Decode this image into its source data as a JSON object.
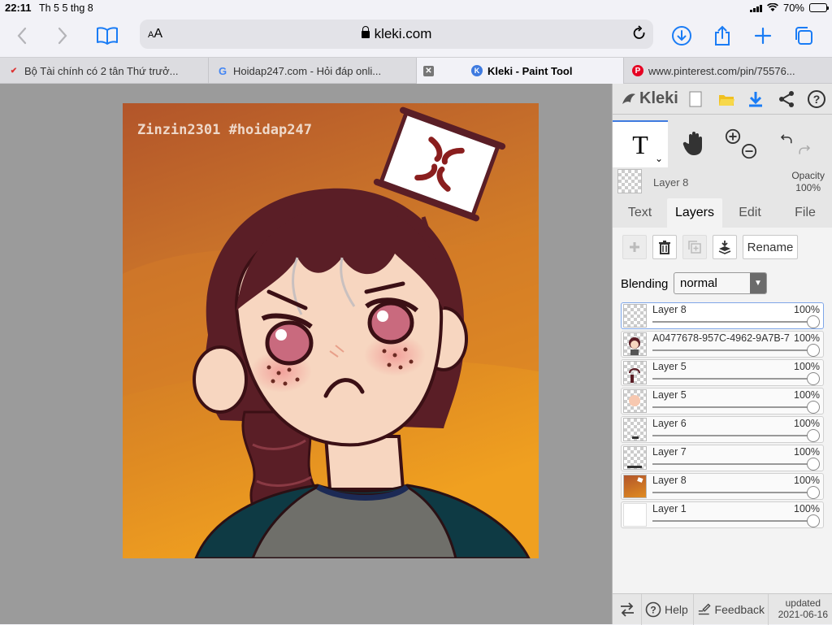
{
  "status": {
    "time": "22:11",
    "date": "Th 5 5 thg 8",
    "battery": "70%",
    "battery_level": 0.7
  },
  "browser": {
    "aa_small": "A",
    "aa_big": "A",
    "url": "kleki.com",
    "tabs": [
      {
        "label": "Bộ Tài chính có 2 tân Thứ trưở..."
      },
      {
        "label": "Hoidap247.com - Hỏi đáp onli..."
      },
      {
        "label": "Kleki - Paint Tool"
      },
      {
        "label": "www.pinterest.com/pin/75576..."
      }
    ]
  },
  "artwork": {
    "watermark": "Zinzin2301 #hoidap247"
  },
  "kleki": {
    "logo": "Kleki",
    "tool_glyph": "T",
    "current_layer": {
      "name": "Layer 8",
      "opacity_label": "Opacity",
      "opacity_value": "100%"
    },
    "tabs": [
      "Text",
      "Layers",
      "Edit",
      "File"
    ],
    "rename_label": "Rename",
    "blending_label": "Blending",
    "blending_value": "normal",
    "layers": [
      {
        "name": "Layer 8",
        "opacity": "100%"
      },
      {
        "name": "A0477678-957C-4962-9A7B-7",
        "opacity": "100%"
      },
      {
        "name": "Layer 5",
        "opacity": "100%"
      },
      {
        "name": "Layer 5",
        "opacity": "100%"
      },
      {
        "name": "Layer 6",
        "opacity": "100%"
      },
      {
        "name": "Layer 7",
        "opacity": "100%"
      },
      {
        "name": "Layer 8",
        "opacity": "100%"
      },
      {
        "name": "Layer 1",
        "opacity": "100%"
      }
    ],
    "footer": {
      "help": "Help",
      "feedback": "Feedback",
      "updated_label": "updated",
      "updated_date": "2021-06-16"
    }
  },
  "colors": {
    "accent": "#1a7cf5",
    "kleki_blue": "#3f7be0",
    "canvas_bg": "#9b9b9b"
  }
}
